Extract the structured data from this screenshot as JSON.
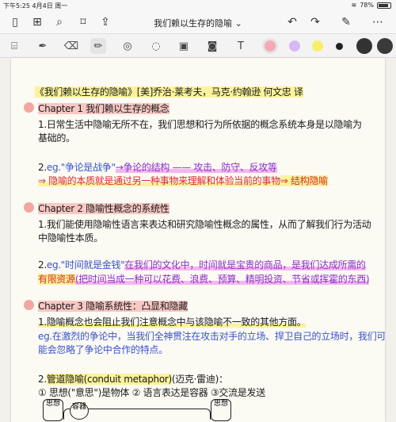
{
  "status_bar": {
    "time": "下午5:25",
    "date": "4月4日 周一",
    "battery": "78%"
  },
  "titlebar": {
    "title": "我们赖以生存的隐喻",
    "chevron": "⌄"
  },
  "icons": {
    "sidebar": "sidebar-icon",
    "grid": "grid-icon",
    "search": "search-icon",
    "bookmark": "bookmark-icon",
    "share": "share-icon",
    "undo": "undo-icon",
    "redo": "redo-icon",
    "edit": "pencil-icon",
    "more": "more-icon"
  },
  "toolbar_colors": {
    "pink": "#f5a9b8",
    "lavender": "#d7b8f5",
    "yellow": "#f7ef6a",
    "black_small": "#222222",
    "black_large": "#333333",
    "dark": "#3a3a3a"
  },
  "note": {
    "header": "《我们赖以生存的隐喻》[美]乔治·莱考夫，马克·约翰逊  何文忠 译",
    "ch1_title": "Chapter 1  我们赖以生存的概念",
    "ch1_p1a": "1.日常生活中隐喻无所不在，我们思想和行为所依据的概念系统本身是以隐喻为",
    "ch1_p1b": "基础的。",
    "ch1_p2a_num": "2.",
    "ch1_p2a_eg": "eg.\"争论是战争\"",
    "ch1_p2a_rest": "→争论的结构 —— 攻击、防守、反攻等",
    "ch1_p2b": "⇒ 隐喻的本质就是通过另一种事物来理解和体验当前的事物",
    "ch1_p2b_end": "⇒ 结构隐喻",
    "ch2_title": "Chapter 2  隐喻性概念的系统性",
    "ch2_p1a": "1.我们能使用隐喻性语言来表达和研究隐喻性概念的属性，从而了解我们行为活动",
    "ch2_p1b": "中隐喻性本质。",
    "ch2_p2a_num": "2.",
    "ch2_p2a_eg": "eg.\"时间就是金钱\"",
    "ch2_p2a_rest": "在我们的文化中，时间就是宝贵的商品，是我们达成所需的",
    "ch2_p2b_hl": "有限资源",
    "ch2_p2b_rest": "(把时间当成一种可以花费、浪费、预算、精明投资、节省或挥霍的东西)",
    "ch3_title": "Chapter 3  隐喻系统性：凸显和隐藏",
    "ch3_p1a": "1.隐喻概念也会阻止我们注意概念中与该隐喻不一致的其他方面。",
    "ch3_p1b": "eg.在激烈的争论中，当我们全神贯注在攻击对手的立场、捍卫自己的立场时，我们可",
    "ch3_p1c": "能会忽略了争论中合作的特点。",
    "ch3_p2a_num": "2.",
    "ch3_p2a_hl": "管道隐喻(conduit metaphor)",
    "ch3_p2a_rest": "(迈克·雷迪)：",
    "ch3_p2b": "① 思想(\"意思\")是物体  ② 语言表达是容器  ③交流是发送",
    "diagram_left": "思想",
    "diagram_mid": "容器",
    "diagram_right": "思想"
  }
}
